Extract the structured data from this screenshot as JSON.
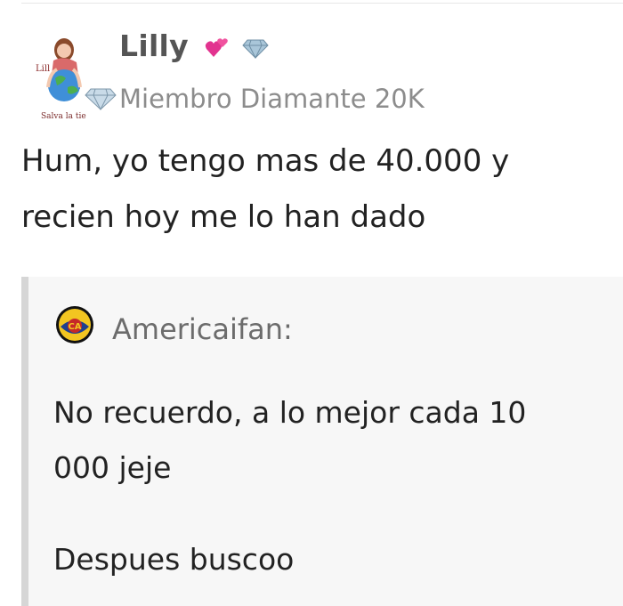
{
  "post": {
    "author_name": "Lilly",
    "author_badge": "Miembro Diamante 20K",
    "avatar_text_top": "Lill",
    "avatar_text_bottom": "Salva la tie",
    "body_line1": "Hum, yo tengo mas de 40.000 y",
    "body_line2": "recien hoy me lo han dado",
    "name_icons": [
      "hearts-icon",
      "diamond-icon"
    ],
    "badge_icon": "diamond-icon"
  },
  "quote": {
    "author": "Americaifan:",
    "avatar_icon": "club-america-crest-icon",
    "line1": "No recuerdo, a lo mejor cada 10",
    "line2": "000 jeje",
    "line3": "Despues buscoo"
  },
  "colors": {
    "quote_background": "#f7f7f7",
    "quote_border": "#d6d6d6",
    "author_name": "#555555",
    "badge_text": "#8c8c8c",
    "hearts": "#e2338f",
    "crest_yellow": "#f2c521",
    "crest_blue": "#1f3f8f"
  }
}
